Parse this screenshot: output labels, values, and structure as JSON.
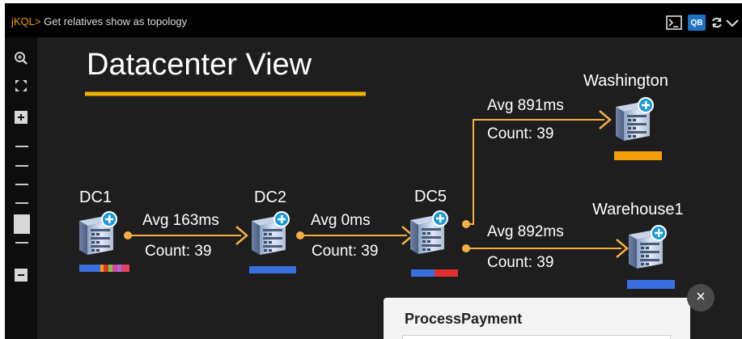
{
  "query": {
    "prompt": "jKQL>",
    "text": "Get relatives show as topology"
  },
  "toolbar": {
    "qb_label": "QB"
  },
  "annotation": {
    "title": "Datacenter View"
  },
  "nodes": [
    {
      "id": "dc1",
      "label": "DC1"
    },
    {
      "id": "dc2",
      "label": "DC2"
    },
    {
      "id": "dc5",
      "label": "DC5"
    },
    {
      "id": "washington",
      "label": "Washington"
    },
    {
      "id": "warehouse1",
      "label": "Warehouse1"
    }
  ],
  "edges": [
    {
      "from": "DC1",
      "to": "DC2",
      "avg": "Avg 163ms",
      "count": "Count: 39"
    },
    {
      "from": "DC2",
      "to": "DC5",
      "avg": "Avg 0ms",
      "count": "Count: 39"
    },
    {
      "from": "DC5",
      "to": "Washington",
      "avg": "Avg 891ms",
      "count": "Count: 39"
    },
    {
      "from": "DC5",
      "to": "Warehouse1",
      "avg": "Avg 892ms",
      "count": "Count: 39"
    }
  ],
  "popup": {
    "title": "ProcessPayment",
    "close": "×"
  },
  "colors": {
    "edge": "#f5b041",
    "accent": "#f0a000",
    "bar_blue": "#3a6fe0",
    "bar_red": "#e03030",
    "bar_orange": "#f59e0b",
    "badge": "#1a9ad6"
  },
  "icons": [
    "zoom-in-icon",
    "fit-to-screen-icon",
    "zoom-plus-icon",
    "zoom-minus-icon",
    "terminal-icon",
    "refresh-icon",
    "chevron-down-icon",
    "server-icon",
    "plus-badge-icon",
    "close-icon"
  ]
}
